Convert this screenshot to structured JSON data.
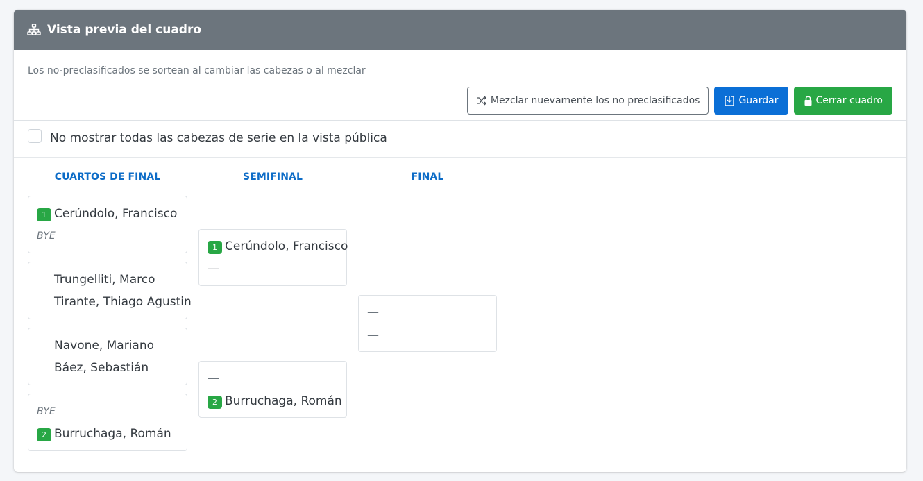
{
  "header": {
    "title": "Vista previa del cuadro",
    "icon": "sitemap-icon",
    "background": "#6c757d"
  },
  "subtitle": "Los no-preclasificados se sortean al cambiar las cabezas o al mezclar",
  "toolbar": {
    "shuffle_label": "Mezclar nuevamente los no preclasificados",
    "save_label": "Guardar",
    "close_label": "Cerrar cuadro"
  },
  "options": {
    "hide_seeds_label": "No mostrar todas las cabezas de serie en la vista pública",
    "hide_seeds_checked": false
  },
  "bracket": {
    "rounds": [
      {
        "title": "CUARTOS DE FINAL",
        "matches": [
          {
            "slots": [
              {
                "seed": "1",
                "name": "Cerúndolo, Francisco"
              },
              {
                "bye": "BYE"
              }
            ]
          },
          {
            "slots": [
              {
                "name": "Trungelliti, Marco"
              },
              {
                "name": "Tirante, Thiago Agustin"
              }
            ]
          },
          {
            "slots": [
              {
                "name": "Navone, Mariano"
              },
              {
                "name": "Báez, Sebastián"
              }
            ]
          },
          {
            "slots": [
              {
                "bye": "BYE"
              },
              {
                "seed": "2",
                "name": "Burruchaga, Román"
              }
            ]
          }
        ]
      },
      {
        "title": "SEMIFINAL",
        "matches": [
          {
            "slots": [
              {
                "seed": "1",
                "name": "Cerúndolo, Francisco"
              },
              {
                "empty": "—"
              }
            ]
          },
          {
            "slots": [
              {
                "empty": "—"
              },
              {
                "seed": "2",
                "name": "Burruchaga, Román"
              }
            ]
          }
        ]
      },
      {
        "title": "FINAL",
        "matches": [
          {
            "slots": [
              {
                "empty": "—"
              },
              {
                "empty": "—"
              }
            ]
          }
        ]
      }
    ]
  },
  "colors": {
    "primary": "#0b6fd6",
    "success": "#28a745",
    "round_title": "#0d6cc7"
  }
}
